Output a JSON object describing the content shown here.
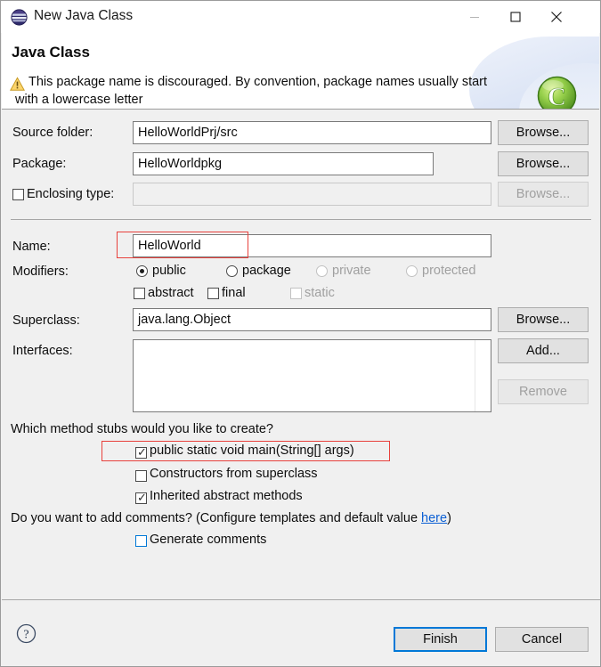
{
  "window": {
    "title": "New Java Class",
    "icon": "eclipse-icon",
    "controls": {
      "minimize": "minimize-icon",
      "maximize": "maximize-icon",
      "close": "close-icon"
    }
  },
  "banner": {
    "title": "Java Class",
    "warning_icon": "warning-icon",
    "message_line1": "This package name is discouraged. By convention, package names usually start",
    "message_line2": "with a lowercase letter",
    "badge_icon": "java-class-badge-icon",
    "badge_letter": "C"
  },
  "form": {
    "source_folder": {
      "label": "Source folder:",
      "value": "HelloWorldPrj/src",
      "browse": "Browse..."
    },
    "package": {
      "label": "Package:",
      "value": "HelloWorldpkg",
      "browse": "Browse..."
    },
    "enclosing_type": {
      "label": "Enclosing type:",
      "checked": false,
      "value": "",
      "browse": "Browse...",
      "enabled": false
    },
    "name": {
      "label": "Name:",
      "value": "HelloWorld"
    },
    "modifiers": {
      "label": "Modifiers:",
      "radios": [
        {
          "label": "public",
          "selected": true,
          "enabled": true
        },
        {
          "label": "package",
          "selected": false,
          "enabled": true
        },
        {
          "label": "private",
          "selected": false,
          "enabled": false
        },
        {
          "label": "protected",
          "selected": false,
          "enabled": false
        }
      ],
      "checkboxes": [
        {
          "label": "abstract",
          "checked": false,
          "enabled": true
        },
        {
          "label": "final",
          "checked": false,
          "enabled": true
        },
        {
          "label": "static",
          "checked": false,
          "enabled": false
        }
      ]
    },
    "superclass": {
      "label": "Superclass:",
      "value": "java.lang.Object",
      "browse": "Browse..."
    },
    "interfaces": {
      "label": "Interfaces:",
      "items": [],
      "add": "Add...",
      "remove": "Remove",
      "remove_enabled": false
    }
  },
  "stubs": {
    "question": "Which method stubs would you like to create?",
    "options": [
      {
        "label": "public static void main(String[] args)",
        "checked": true,
        "highlighted": true
      },
      {
        "label": "Constructors from superclass",
        "checked": false,
        "highlighted": false
      },
      {
        "label": "Inherited abstract methods",
        "checked": true,
        "highlighted": false
      }
    ]
  },
  "comments": {
    "question_prefix": "Do you want to add comments? (Configure templates and default value ",
    "link": "here",
    "question_suffix": ")",
    "generate": {
      "label": "Generate comments",
      "checked": false,
      "focused": true
    }
  },
  "footer": {
    "help_icon": "help-icon",
    "finish": "Finish",
    "cancel": "Cancel"
  },
  "colors": {
    "annotation": "#e8413c",
    "focus": "#0078d7",
    "link": "#0b5fd4",
    "badge_green": "#7ac143"
  }
}
